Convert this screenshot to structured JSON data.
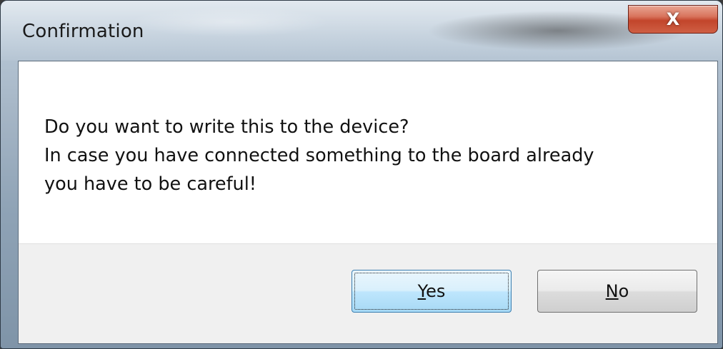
{
  "window": {
    "title": "Confirmation",
    "close_label": "X"
  },
  "message": {
    "lines": [
      "Do you want to write this to the device?",
      "In case you have connected something to the board already",
      "you have to be careful!"
    ]
  },
  "buttons": {
    "yes": {
      "mnemonic": "Y",
      "rest": "es"
    },
    "no": {
      "mnemonic": "N",
      "rest": "o"
    }
  },
  "colors": {
    "close_button": "#c2452b",
    "default_button_border": "#3c7fb1",
    "button_area": "#f0f0f0"
  }
}
